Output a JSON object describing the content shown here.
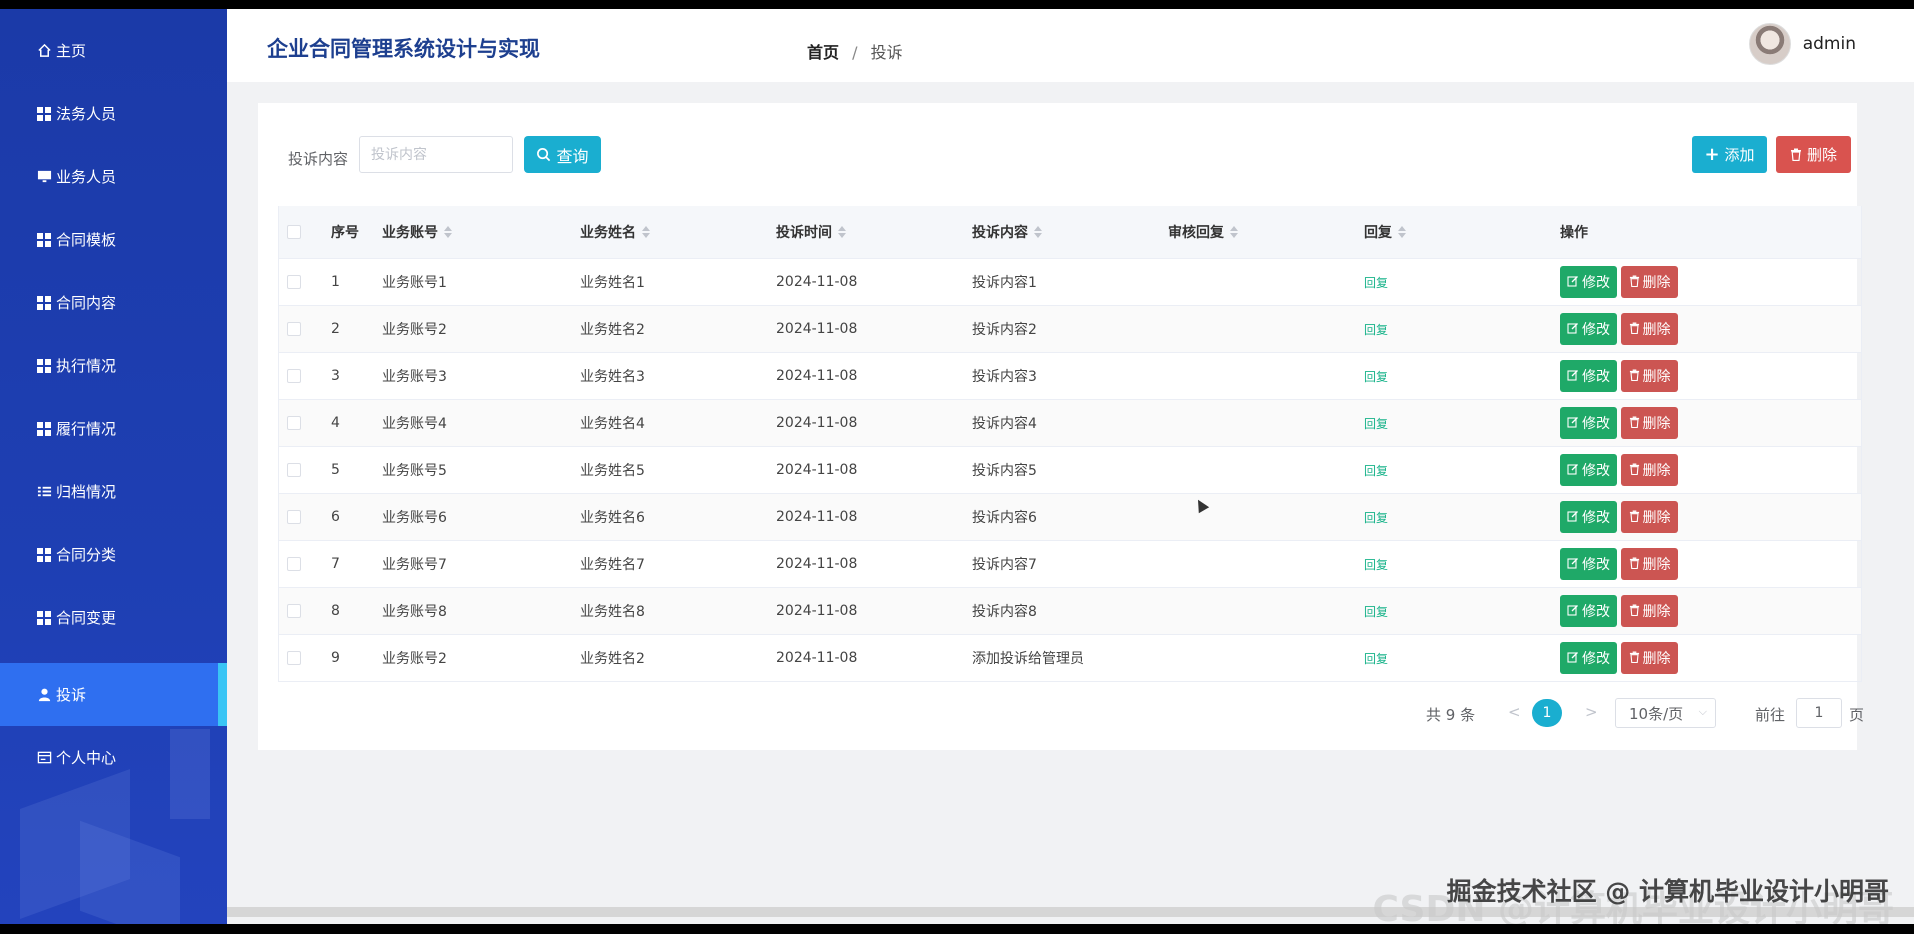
{
  "header": {
    "system_title": "企业合同管理系统设计与实现",
    "breadcrumb_home": "首页",
    "breadcrumb_sep": "/",
    "breadcrumb_current": "投诉",
    "username": "admin"
  },
  "sidebar": {
    "items": [
      {
        "label": "主页",
        "icon": "home-icon"
      },
      {
        "label": "法务人员",
        "icon": "grid-icon"
      },
      {
        "label": "业务人员",
        "icon": "monitor-icon"
      },
      {
        "label": "合同模板",
        "icon": "grid-icon"
      },
      {
        "label": "合同内容",
        "icon": "grid-icon"
      },
      {
        "label": "执行情况",
        "icon": "grid-icon"
      },
      {
        "label": "履行情况",
        "icon": "grid-icon"
      },
      {
        "label": "归档情况",
        "icon": "list-icon"
      },
      {
        "label": "合同分类",
        "icon": "grid-icon"
      },
      {
        "label": "合同变更",
        "icon": "grid-icon"
      },
      {
        "label": "投诉",
        "icon": "user-icon",
        "active": true
      },
      {
        "label": "个人中心",
        "icon": "card-icon"
      }
    ]
  },
  "search": {
    "label": "投诉内容",
    "placeholder": "投诉内容",
    "query_label": "查询",
    "add_label": "添加",
    "delete_label": "删除"
  },
  "table": {
    "headers": {
      "no": "序号",
      "account": "业务账号",
      "name": "业务姓名",
      "time": "投诉时间",
      "content": "投诉内容",
      "audit": "审核回复",
      "reply": "回复",
      "op": "操作"
    },
    "reply_label": "回复",
    "edit_label": "修改",
    "delete_label": "删除",
    "rows": [
      {
        "no": "1",
        "account": "业务账号1",
        "name": "业务姓名1",
        "time": "2024-11-08",
        "content": "投诉内容1",
        "audit": ""
      },
      {
        "no": "2",
        "account": "业务账号2",
        "name": "业务姓名2",
        "time": "2024-11-08",
        "content": "投诉内容2",
        "audit": ""
      },
      {
        "no": "3",
        "account": "业务账号3",
        "name": "业务姓名3",
        "time": "2024-11-08",
        "content": "投诉内容3",
        "audit": ""
      },
      {
        "no": "4",
        "account": "业务账号4",
        "name": "业务姓名4",
        "time": "2024-11-08",
        "content": "投诉内容4",
        "audit": ""
      },
      {
        "no": "5",
        "account": "业务账号5",
        "name": "业务姓名5",
        "time": "2024-11-08",
        "content": "投诉内容5",
        "audit": ""
      },
      {
        "no": "6",
        "account": "业务账号6",
        "name": "业务姓名6",
        "time": "2024-11-08",
        "content": "投诉内容6",
        "audit": ""
      },
      {
        "no": "7",
        "account": "业务账号7",
        "name": "业务姓名7",
        "time": "2024-11-08",
        "content": "投诉内容7",
        "audit": ""
      },
      {
        "no": "8",
        "account": "业务账号8",
        "name": "业务姓名8",
        "time": "2024-11-08",
        "content": "投诉内容8",
        "audit": ""
      },
      {
        "no": "9",
        "account": "业务账号2",
        "name": "业务姓名2",
        "time": "2024-11-08",
        "content": "添加投诉给管理员",
        "audit": ""
      }
    ]
  },
  "pagination": {
    "total": "共 9 条",
    "prev": "<",
    "current_page": "1",
    "next": ">",
    "page_size": "10条/页",
    "goto_label": "前往",
    "goto_value": "1",
    "page_suffix": "页"
  },
  "watermark": "掘金技术社区 @ 计算机毕业设计小明哥",
  "watermark_bg": "CSDN @计算机毕业设计小明哥",
  "colors": {
    "sidebar": "#1e3fb3",
    "active_item": "#2f6ff0",
    "primary": "#1aaed0",
    "danger": "#d9534f",
    "edit": "#1fa968",
    "reply_link": "#18b38a"
  }
}
